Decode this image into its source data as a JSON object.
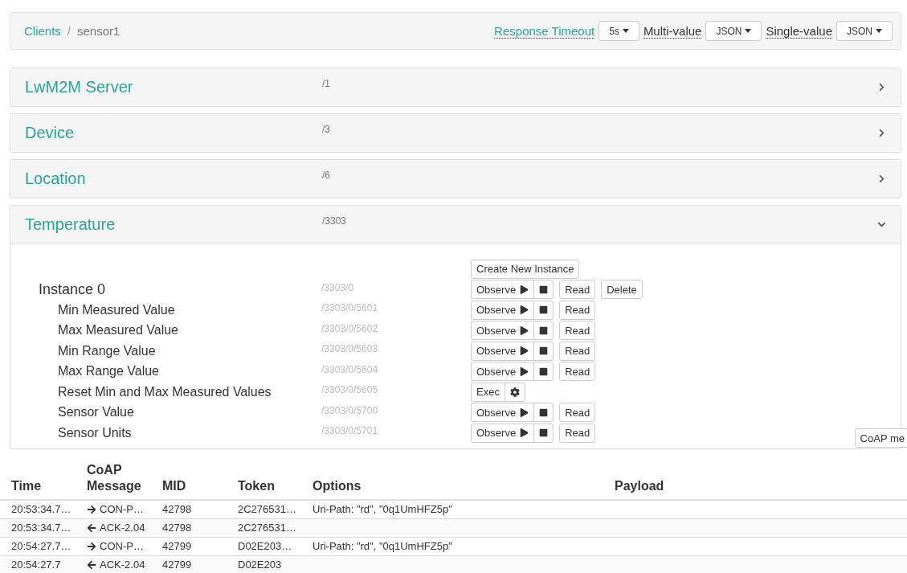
{
  "breadcrumb": {
    "separator": "/",
    "items": [
      {
        "label": "Clients",
        "link": true
      },
      {
        "label": "sensor1",
        "link": false
      }
    ]
  },
  "settings": [
    {
      "label": "Response Timeout",
      "value": "5s",
      "link": true
    },
    {
      "label": "Multi-value",
      "value": "JSON",
      "link": false
    },
    {
      "label": "Single-value",
      "value": "JSON",
      "link": false
    }
  ],
  "objects": [
    {
      "name": "LwM2M Server",
      "path": "/1",
      "expanded": false
    },
    {
      "name": "Device",
      "path": "/3",
      "expanded": false
    },
    {
      "name": "Location",
      "path": "/6",
      "expanded": false
    },
    {
      "name": "Temperature",
      "path": "/3303",
      "expanded": true,
      "create_button": "Create New Instance",
      "instances": [
        {
          "name": "Instance 0",
          "path": "/3303/0",
          "observe": "Observe",
          "read": "Read",
          "delete": "Delete",
          "resources": [
            {
              "kind": "observe",
              "name": "Min Measured Value",
              "path": "/3303/0/5601",
              "observe": "Observe",
              "read": "Read"
            },
            {
              "kind": "observe",
              "name": "Max Measured Value",
              "path": "/3303/0/5602",
              "observe": "Observe",
              "read": "Read"
            },
            {
              "kind": "observe",
              "name": "Min Range Value",
              "path": "/3303/0/5603",
              "observe": "Observe",
              "read": "Read"
            },
            {
              "kind": "observe",
              "name": "Max Range Value",
              "path": "/3303/0/5604",
              "observe": "Observe",
              "read": "Read"
            },
            {
              "kind": "exec",
              "name": "Reset Min and Max Measured Values",
              "path": "/3303/0/5605",
              "exec": "Exec"
            },
            {
              "kind": "observe",
              "name": "Sensor Value",
              "path": "/3303/0/5700",
              "observe": "Observe",
              "read": "Read"
            },
            {
              "kind": "observe",
              "name": "Sensor Units",
              "path": "/3303/0/5701",
              "observe": "Observe",
              "read": "Read"
            }
          ]
        }
      ]
    }
  ],
  "coap_button": "CoAP me",
  "log": {
    "columns": [
      "Time",
      "CoAP Message",
      "MID",
      "Token",
      "Options",
      "Payload"
    ],
    "rows": [
      {
        "time": "20:53:34.7…",
        "kind": "out",
        "message": "CON-P…",
        "mid": "42798",
        "token": "2C276531…",
        "options": "Uri-Path: \"rd\", \"0q1UmHFZ5p\""
      },
      {
        "time": "20:53:34.7…",
        "kind": "in",
        "message": "ACK-2.04",
        "mid": "42798",
        "token": "2C276531…",
        "options": ""
      },
      {
        "time": "20:54:27.7…",
        "kind": "out",
        "message": "CON-P…",
        "mid": "42799",
        "token": "D02E203…",
        "options": "Uri-Path: \"rd\", \"0q1UmHFZ5p\""
      },
      {
        "time": "20:54:27.7",
        "kind": "in",
        "message": "ACK-2.04",
        "mid": "42799",
        "token": "D02E203",
        "options": ""
      }
    ]
  }
}
